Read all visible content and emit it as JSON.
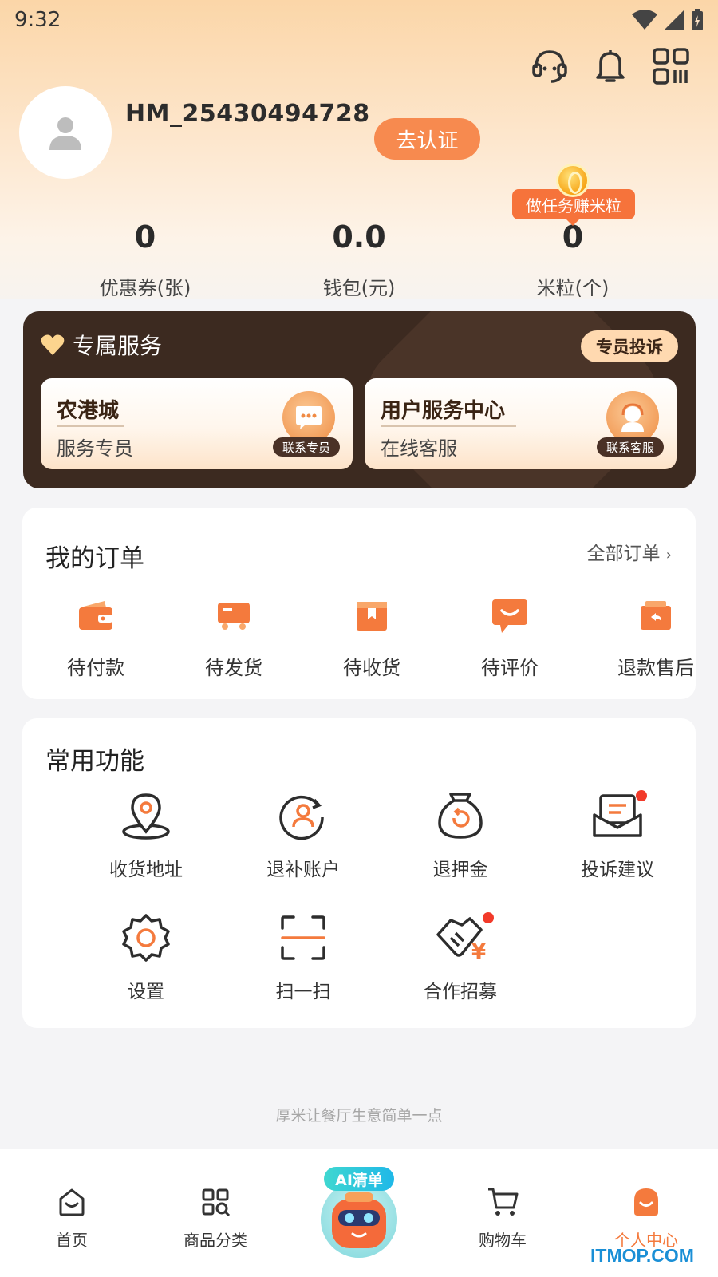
{
  "status": {
    "time": "9:32"
  },
  "user": {
    "name": "HM_25430494728",
    "verify_label": "去认证"
  },
  "task_bubble": "做任务赚米粒",
  "stats": [
    {
      "value": "0",
      "label": "优惠券(张)"
    },
    {
      "value": "0.0",
      "label": "钱包(元)"
    },
    {
      "value": "0",
      "label": "米粒(个)"
    }
  ],
  "service": {
    "title": "专属服务",
    "complain_label": "专员投诉",
    "boxes": [
      {
        "title": "农港城",
        "subtitle": "服务专员",
        "tag": "联系专员"
      },
      {
        "title": "用户服务中心",
        "subtitle": "在线客服",
        "tag": "联系客服"
      }
    ]
  },
  "orders": {
    "title": "我的订单",
    "all_label": "全部订单",
    "items": [
      {
        "label": "待付款",
        "icon": "wallet-icon"
      },
      {
        "label": "待发货",
        "icon": "truck-icon"
      },
      {
        "label": "待收货",
        "icon": "box-icon"
      },
      {
        "label": "待评价",
        "icon": "comment-icon"
      },
      {
        "label": "退款售后",
        "icon": "refund-icon"
      }
    ]
  },
  "functions": {
    "title": "常用功能",
    "items": [
      {
        "label": "收货地址",
        "icon": "location-icon"
      },
      {
        "label": "退补账户",
        "icon": "account-icon"
      },
      {
        "label": "退押金",
        "icon": "deposit-icon"
      },
      {
        "label": "投诉建议",
        "icon": "feedback-icon"
      },
      {
        "label": "设置",
        "icon": "gear-icon"
      },
      {
        "label": "扫一扫",
        "icon": "scan-icon"
      },
      {
        "label": "合作招募",
        "icon": "handshake-icon"
      }
    ]
  },
  "slogan": "厚米让餐厅生意简单一点",
  "tabbar": {
    "items": [
      {
        "label": "首页",
        "icon": "home-icon"
      },
      {
        "label": "商品分类",
        "icon": "category-icon"
      },
      {
        "label": "购物车",
        "icon": "cart-icon"
      },
      {
        "label": "个人中心",
        "icon": "profile-icon"
      }
    ],
    "ai_label": "AI清单"
  },
  "watermark": "ITMOP.COM",
  "colors": {
    "accent": "#f47a3d",
    "service_bg": "#3c2a20",
    "verify_btn": "#f78a4f"
  }
}
